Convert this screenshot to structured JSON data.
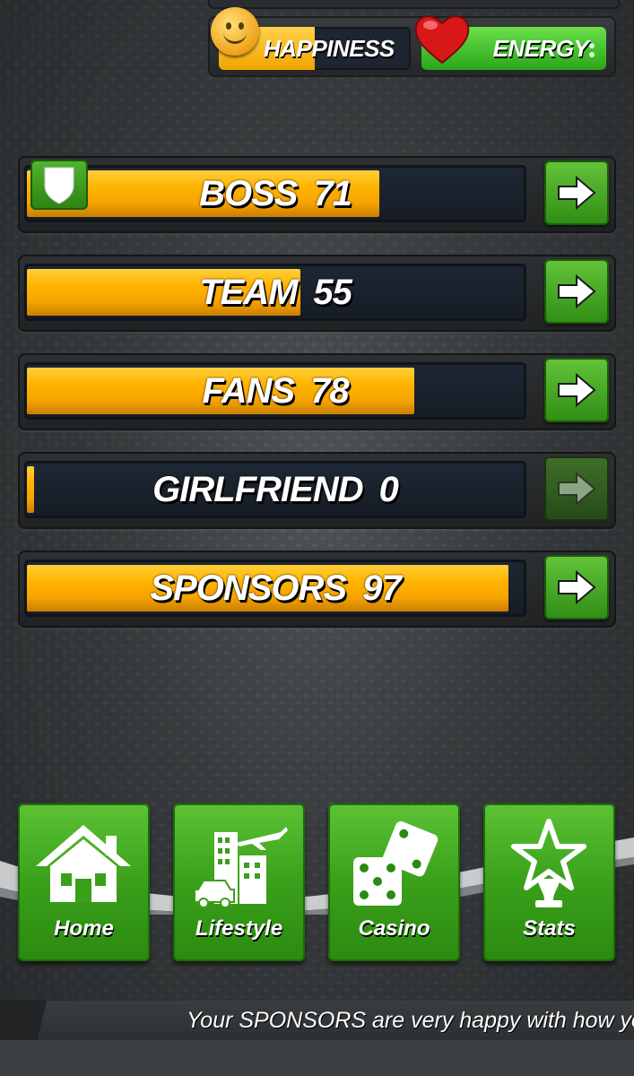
{
  "meters": {
    "happiness": {
      "label": "HAPPINESS",
      "level": 0.5,
      "color": "#f2a400"
    },
    "energy": {
      "label": "ENERGY",
      "level": 1.0,
      "color": "#2aa61a"
    }
  },
  "relationships": [
    {
      "name": "BOSS",
      "value": "71",
      "level": 0.71,
      "badge": "shield-icon",
      "enabled": true
    },
    {
      "name": "TEAM",
      "value": "55",
      "level": 0.55,
      "enabled": true
    },
    {
      "name": "FANS",
      "value": "78",
      "level": 0.78,
      "enabled": true
    },
    {
      "name": "GIRLFRIEND",
      "value": "0",
      "level": 0.0,
      "enabled": false
    },
    {
      "name": "SPONSORS",
      "value": "97",
      "level": 0.97,
      "enabled": true
    }
  ],
  "nav": {
    "home": {
      "label": "Home",
      "icon": "house-icon"
    },
    "lifestyle": {
      "label": "Lifestyle",
      "icon": "city-icon"
    },
    "casino": {
      "label": "Casino",
      "icon": "dice-icon"
    },
    "stats": {
      "label": "Stats",
      "icon": "trophy-icon"
    }
  },
  "ticker": {
    "message": "Your SPONSORS are very happy with how you"
  },
  "colors": {
    "accent_green": "#3aa01a",
    "bar_orange": "#ffb400",
    "background": "#3f4345"
  }
}
